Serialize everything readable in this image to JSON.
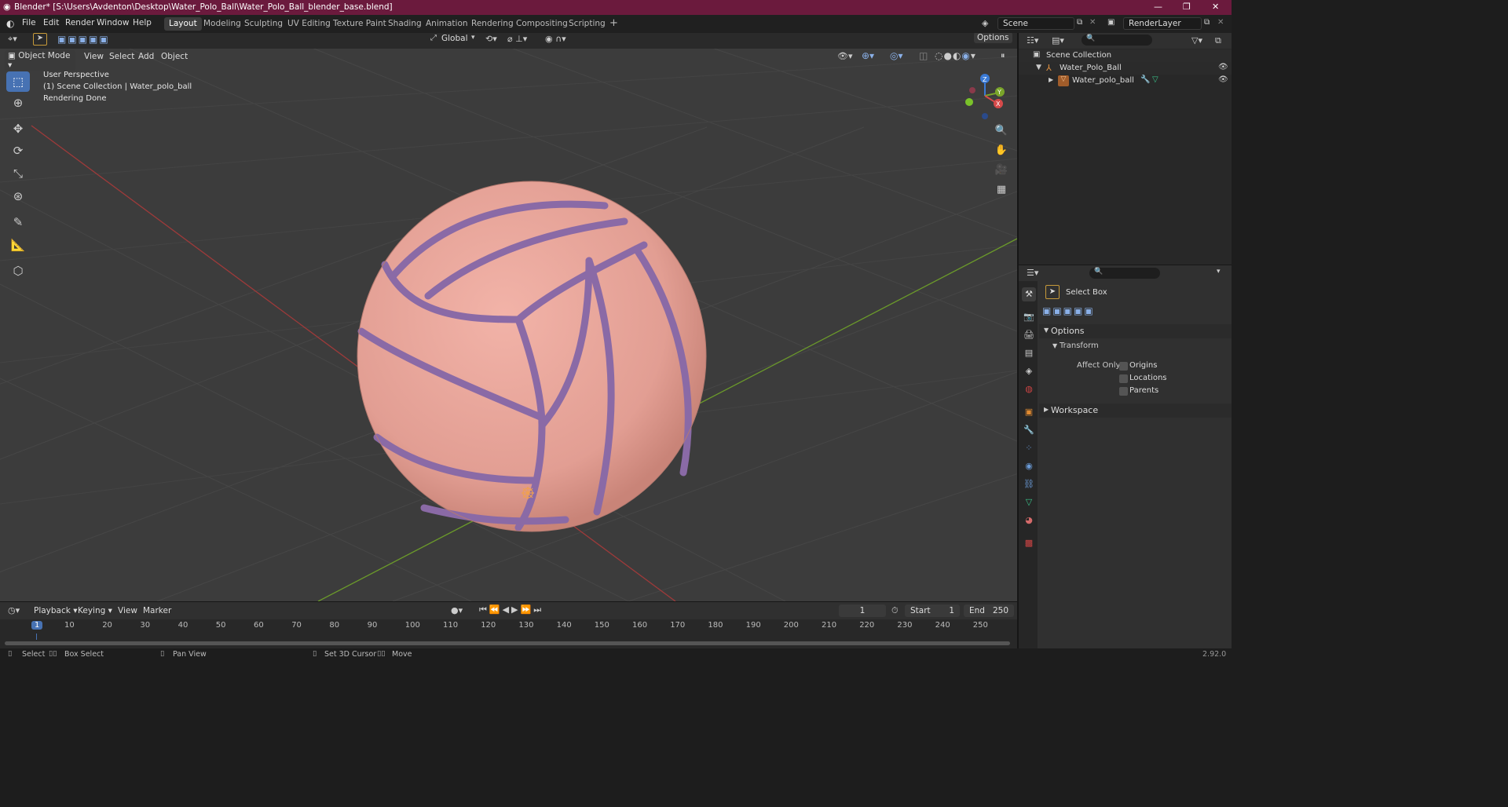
{
  "window": {
    "title": "Blender* [S:\\Users\\Avdenton\\Desktop\\Water_Polo_Ball\\Water_Polo_Ball_blender_base.blend]"
  },
  "menu": [
    "File",
    "Edit",
    "Render",
    "Window",
    "Help"
  ],
  "workspaces": [
    "Layout",
    "Modeling",
    "Sculpting",
    "UV Editing",
    "Texture Paint",
    "Shading",
    "Animation",
    "Rendering",
    "Compositing",
    "Scripting"
  ],
  "active_workspace": "Layout",
  "scene": {
    "name": "Scene",
    "render_layer": "RenderLayer"
  },
  "toolbar_top": {
    "orientation": "Global",
    "options_label": "Options"
  },
  "viewport_header": {
    "mode": "Object Mode",
    "menus": [
      "View",
      "Select",
      "Add",
      "Object"
    ]
  },
  "overlay_text": {
    "line1": "User Perspective",
    "line2": "(1) Scene Collection | Water_polo_ball",
    "line3": "Rendering Done"
  },
  "gizmo_axes": {
    "x": "X",
    "y": "Y",
    "z": "Z"
  },
  "outliner": {
    "root": "Scene Collection",
    "items": [
      {
        "label": "Water_Polo_Ball"
      },
      {
        "label": "Water_polo_ball"
      }
    ]
  },
  "properties": {
    "tool_name": "Select Box",
    "options_label": "Options",
    "transform_label": "Transform",
    "affect_only_label": "Affect Only",
    "checkboxes": [
      "Origins",
      "Locations",
      "Parents"
    ],
    "workspace_label": "Workspace"
  },
  "timeline": {
    "menus": [
      "Playback",
      "Keying",
      "View",
      "Marker"
    ],
    "current_frame": "1",
    "start_label": "Start",
    "start": "1",
    "end_label": "End",
    "end": "250",
    "ruler": [
      "1",
      "10",
      "20",
      "30",
      "40",
      "50",
      "60",
      "70",
      "80",
      "90",
      "100",
      "110",
      "120",
      "130",
      "140",
      "150",
      "160",
      "170",
      "180",
      "190",
      "200",
      "210",
      "220",
      "230",
      "240",
      "250"
    ]
  },
  "status": {
    "select": "Select",
    "box_select": "Box Select",
    "pan": "Pan View",
    "cursor": "Set 3D Cursor",
    "move": "Move",
    "version": "2.92.0"
  },
  "colors": {
    "title_bar": "#6b1a3d",
    "accent": "#4772b3",
    "ball": "#e8a69a",
    "seam": "#8a6aa6",
    "x_axis": "#b33a3a",
    "y_axis": "#6b9a2a"
  }
}
